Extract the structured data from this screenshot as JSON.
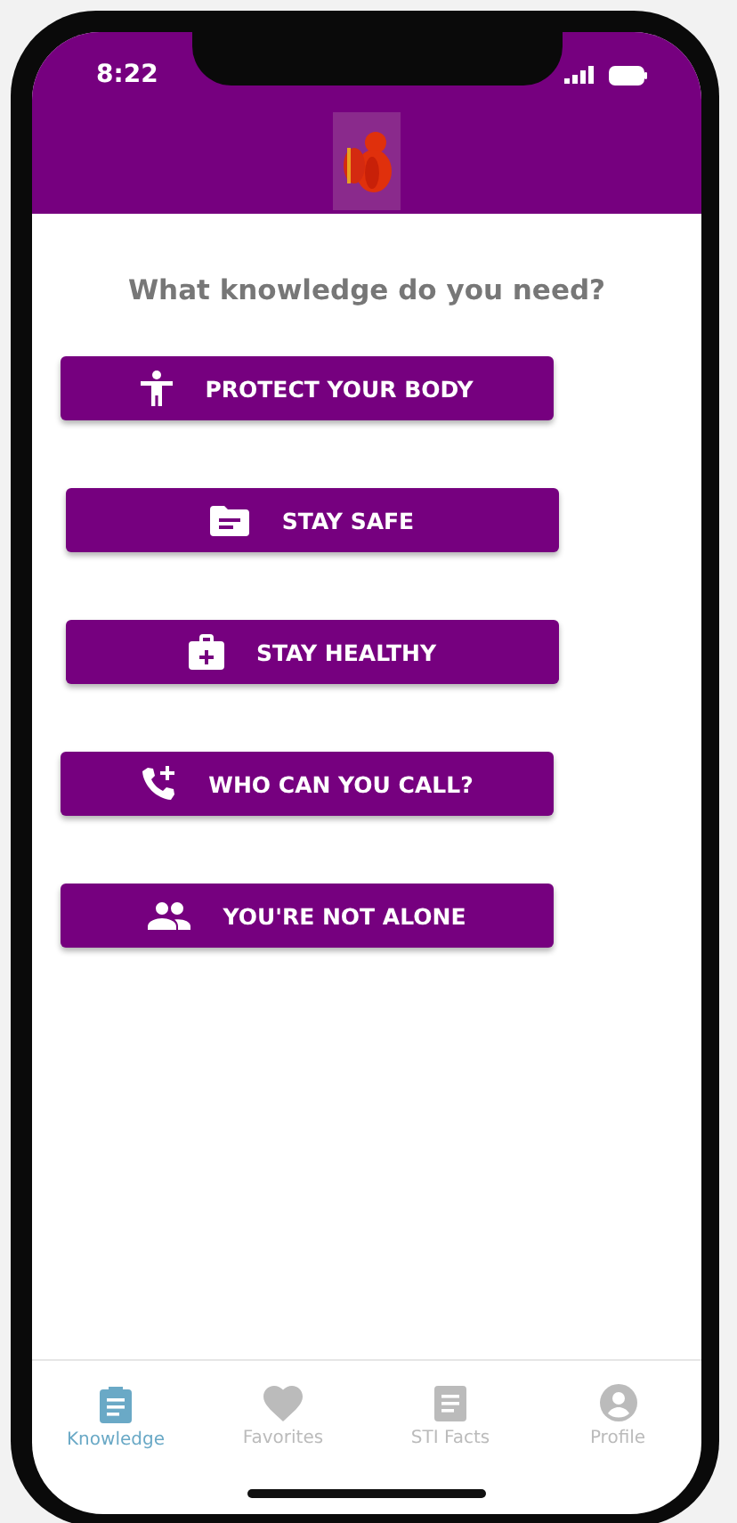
{
  "status_bar": {
    "time": "8:22"
  },
  "heading": "What knowledge do you need?",
  "menu_buttons": [
    {
      "label": "PROTECT YOUR BODY",
      "kind": "body"
    },
    {
      "label": "STAY SAFE",
      "kind": "folder"
    },
    {
      "label": "STAY HEALTHY",
      "kind": "medkit"
    },
    {
      "label": "WHO CAN YOU CALL?",
      "kind": "phone"
    },
    {
      "label": "YOU'RE NOT ALONE",
      "kind": "people"
    }
  ],
  "tabs": [
    {
      "label": "Knowledge",
      "kind": "clipboard",
      "selected": true
    },
    {
      "label": "Favorites",
      "kind": "heart",
      "selected": false
    },
    {
      "label": "STI Facts",
      "kind": "document",
      "selected": false
    },
    {
      "label": "Profile",
      "kind": "person",
      "selected": false
    }
  ]
}
